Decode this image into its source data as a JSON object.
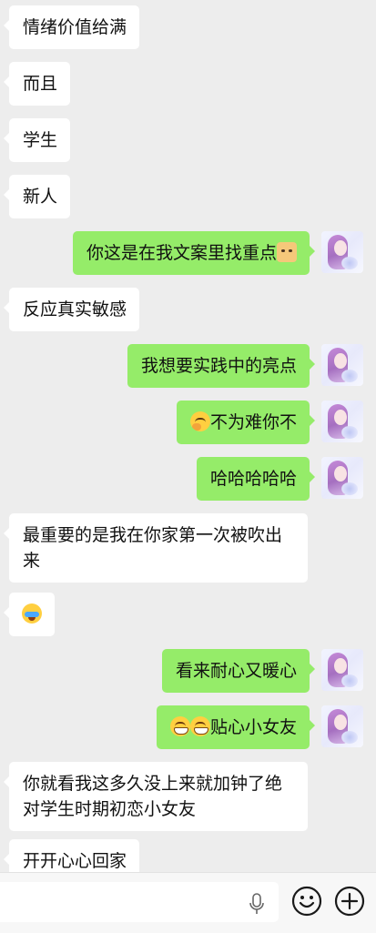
{
  "messages": [
    {
      "side": "in",
      "text": "情绪价值给满"
    },
    {
      "side": "in",
      "text": "而且"
    },
    {
      "side": "in",
      "text": "学生"
    },
    {
      "side": "in",
      "text": "新人"
    },
    {
      "side": "out",
      "text": "你这是在我文案里找重点",
      "emoji_after": "dog-face-icon"
    },
    {
      "side": "in",
      "text": "反应真实敏感"
    },
    {
      "side": "out",
      "text": "我想要实践中的亮点"
    },
    {
      "side": "out",
      "text": "不为难你不",
      "emoji_before": "thinking-face-icon"
    },
    {
      "side": "out",
      "text": "哈哈哈哈哈"
    },
    {
      "side": "in",
      "text": "最重要的是我在你家第一次被吹出来"
    },
    {
      "side": "in",
      "text": "",
      "emoji_only": "loudly-crying-face-icon"
    },
    {
      "side": "out",
      "text": "看来耐心又暖心"
    },
    {
      "side": "out",
      "text": "贴心小女友",
      "emoji_before": "grinning-face-icon"
    },
    {
      "side": "in",
      "text": "你就看我这多久没上来就加钟了绝对学生时期初恋小女友"
    },
    {
      "side": "in",
      "text": "开开心心回家"
    }
  ],
  "input": {
    "value": "",
    "icons": [
      "microphone-icon",
      "emoji-icon",
      "add-icon"
    ]
  },
  "colors": {
    "background": "#ededed",
    "incoming_bubble": "#ffffff",
    "outgoing_bubble": "#95ec69",
    "text": "#111111"
  }
}
